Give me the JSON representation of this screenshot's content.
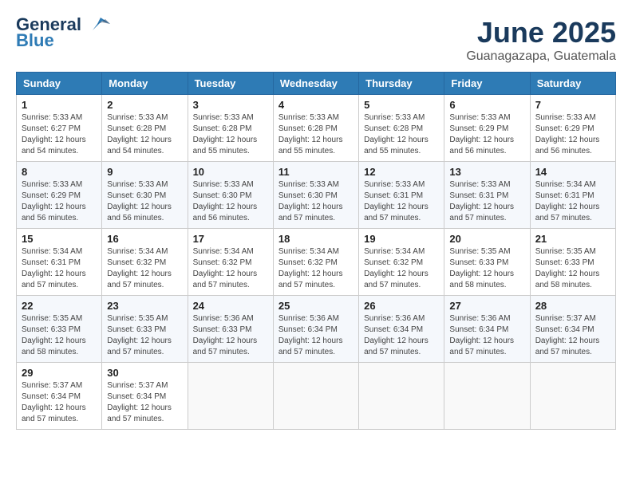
{
  "header": {
    "logo_general": "General",
    "logo_blue": "Blue",
    "month_title": "June 2025",
    "location": "Guanagazapa, Guatemala"
  },
  "weekdays": [
    "Sunday",
    "Monday",
    "Tuesday",
    "Wednesday",
    "Thursday",
    "Friday",
    "Saturday"
  ],
  "weeks": [
    [
      {
        "day": "1",
        "sunrise": "5:33 AM",
        "sunset": "6:27 PM",
        "daylight": "12 hours and 54 minutes."
      },
      {
        "day": "2",
        "sunrise": "5:33 AM",
        "sunset": "6:28 PM",
        "daylight": "12 hours and 54 minutes."
      },
      {
        "day": "3",
        "sunrise": "5:33 AM",
        "sunset": "6:28 PM",
        "daylight": "12 hours and 55 minutes."
      },
      {
        "day": "4",
        "sunrise": "5:33 AM",
        "sunset": "6:28 PM",
        "daylight": "12 hours and 55 minutes."
      },
      {
        "day": "5",
        "sunrise": "5:33 AM",
        "sunset": "6:28 PM",
        "daylight": "12 hours and 55 minutes."
      },
      {
        "day": "6",
        "sunrise": "5:33 AM",
        "sunset": "6:29 PM",
        "daylight": "12 hours and 56 minutes."
      },
      {
        "day": "7",
        "sunrise": "5:33 AM",
        "sunset": "6:29 PM",
        "daylight": "12 hours and 56 minutes."
      }
    ],
    [
      {
        "day": "8",
        "sunrise": "5:33 AM",
        "sunset": "6:29 PM",
        "daylight": "12 hours and 56 minutes."
      },
      {
        "day": "9",
        "sunrise": "5:33 AM",
        "sunset": "6:30 PM",
        "daylight": "12 hours and 56 minutes."
      },
      {
        "day": "10",
        "sunrise": "5:33 AM",
        "sunset": "6:30 PM",
        "daylight": "12 hours and 56 minutes."
      },
      {
        "day": "11",
        "sunrise": "5:33 AM",
        "sunset": "6:30 PM",
        "daylight": "12 hours and 57 minutes."
      },
      {
        "day": "12",
        "sunrise": "5:33 AM",
        "sunset": "6:31 PM",
        "daylight": "12 hours and 57 minutes."
      },
      {
        "day": "13",
        "sunrise": "5:33 AM",
        "sunset": "6:31 PM",
        "daylight": "12 hours and 57 minutes."
      },
      {
        "day": "14",
        "sunrise": "5:34 AM",
        "sunset": "6:31 PM",
        "daylight": "12 hours and 57 minutes."
      }
    ],
    [
      {
        "day": "15",
        "sunrise": "5:34 AM",
        "sunset": "6:31 PM",
        "daylight": "12 hours and 57 minutes."
      },
      {
        "day": "16",
        "sunrise": "5:34 AM",
        "sunset": "6:32 PM",
        "daylight": "12 hours and 57 minutes."
      },
      {
        "day": "17",
        "sunrise": "5:34 AM",
        "sunset": "6:32 PM",
        "daylight": "12 hours and 57 minutes."
      },
      {
        "day": "18",
        "sunrise": "5:34 AM",
        "sunset": "6:32 PM",
        "daylight": "12 hours and 57 minutes."
      },
      {
        "day": "19",
        "sunrise": "5:34 AM",
        "sunset": "6:32 PM",
        "daylight": "12 hours and 57 minutes."
      },
      {
        "day": "20",
        "sunrise": "5:35 AM",
        "sunset": "6:33 PM",
        "daylight": "12 hours and 58 minutes."
      },
      {
        "day": "21",
        "sunrise": "5:35 AM",
        "sunset": "6:33 PM",
        "daylight": "12 hours and 58 minutes."
      }
    ],
    [
      {
        "day": "22",
        "sunrise": "5:35 AM",
        "sunset": "6:33 PM",
        "daylight": "12 hours and 58 minutes."
      },
      {
        "day": "23",
        "sunrise": "5:35 AM",
        "sunset": "6:33 PM",
        "daylight": "12 hours and 57 minutes."
      },
      {
        "day": "24",
        "sunrise": "5:36 AM",
        "sunset": "6:33 PM",
        "daylight": "12 hours and 57 minutes."
      },
      {
        "day": "25",
        "sunrise": "5:36 AM",
        "sunset": "6:34 PM",
        "daylight": "12 hours and 57 minutes."
      },
      {
        "day": "26",
        "sunrise": "5:36 AM",
        "sunset": "6:34 PM",
        "daylight": "12 hours and 57 minutes."
      },
      {
        "day": "27",
        "sunrise": "5:36 AM",
        "sunset": "6:34 PM",
        "daylight": "12 hours and 57 minutes."
      },
      {
        "day": "28",
        "sunrise": "5:37 AM",
        "sunset": "6:34 PM",
        "daylight": "12 hours and 57 minutes."
      }
    ],
    [
      {
        "day": "29",
        "sunrise": "5:37 AM",
        "sunset": "6:34 PM",
        "daylight": "12 hours and 57 minutes."
      },
      {
        "day": "30",
        "sunrise": "5:37 AM",
        "sunset": "6:34 PM",
        "daylight": "12 hours and 57 minutes."
      },
      null,
      null,
      null,
      null,
      null
    ]
  ],
  "labels": {
    "sunrise": "Sunrise:",
    "sunset": "Sunset:",
    "daylight": "Daylight:"
  },
  "colors": {
    "header_bg": "#2e7bb5",
    "title_color": "#1a3a5c"
  }
}
